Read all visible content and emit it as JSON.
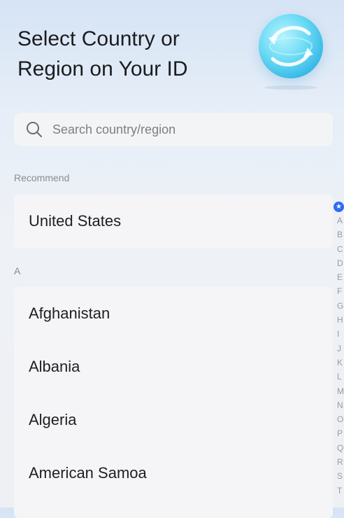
{
  "header": {
    "title_line1": "Select Country or",
    "title_line2": "Region on Your ID"
  },
  "illustration": {
    "icon": "globe-icon",
    "colors": [
      "#6fdcf5",
      "#37b9e6",
      "#ffffff"
    ]
  },
  "search": {
    "placeholder": "Search country/region",
    "value": "",
    "icon": "search-icon"
  },
  "sections": {
    "recommend_label": "Recommend",
    "recommend_items": [
      "United States"
    ],
    "a_label": "A",
    "a_items": [
      "Afghanistan",
      "Albania",
      "Algeria",
      "American Samoa"
    ]
  },
  "index_bar": {
    "star": "★",
    "letters": [
      "A",
      "B",
      "C",
      "D",
      "E",
      "F",
      "G",
      "H",
      "I",
      "J",
      "K",
      "L",
      "M",
      "N",
      "O",
      "P",
      "Q",
      "R",
      "S",
      "T"
    ],
    "accent_color": "#2c6cf0"
  }
}
